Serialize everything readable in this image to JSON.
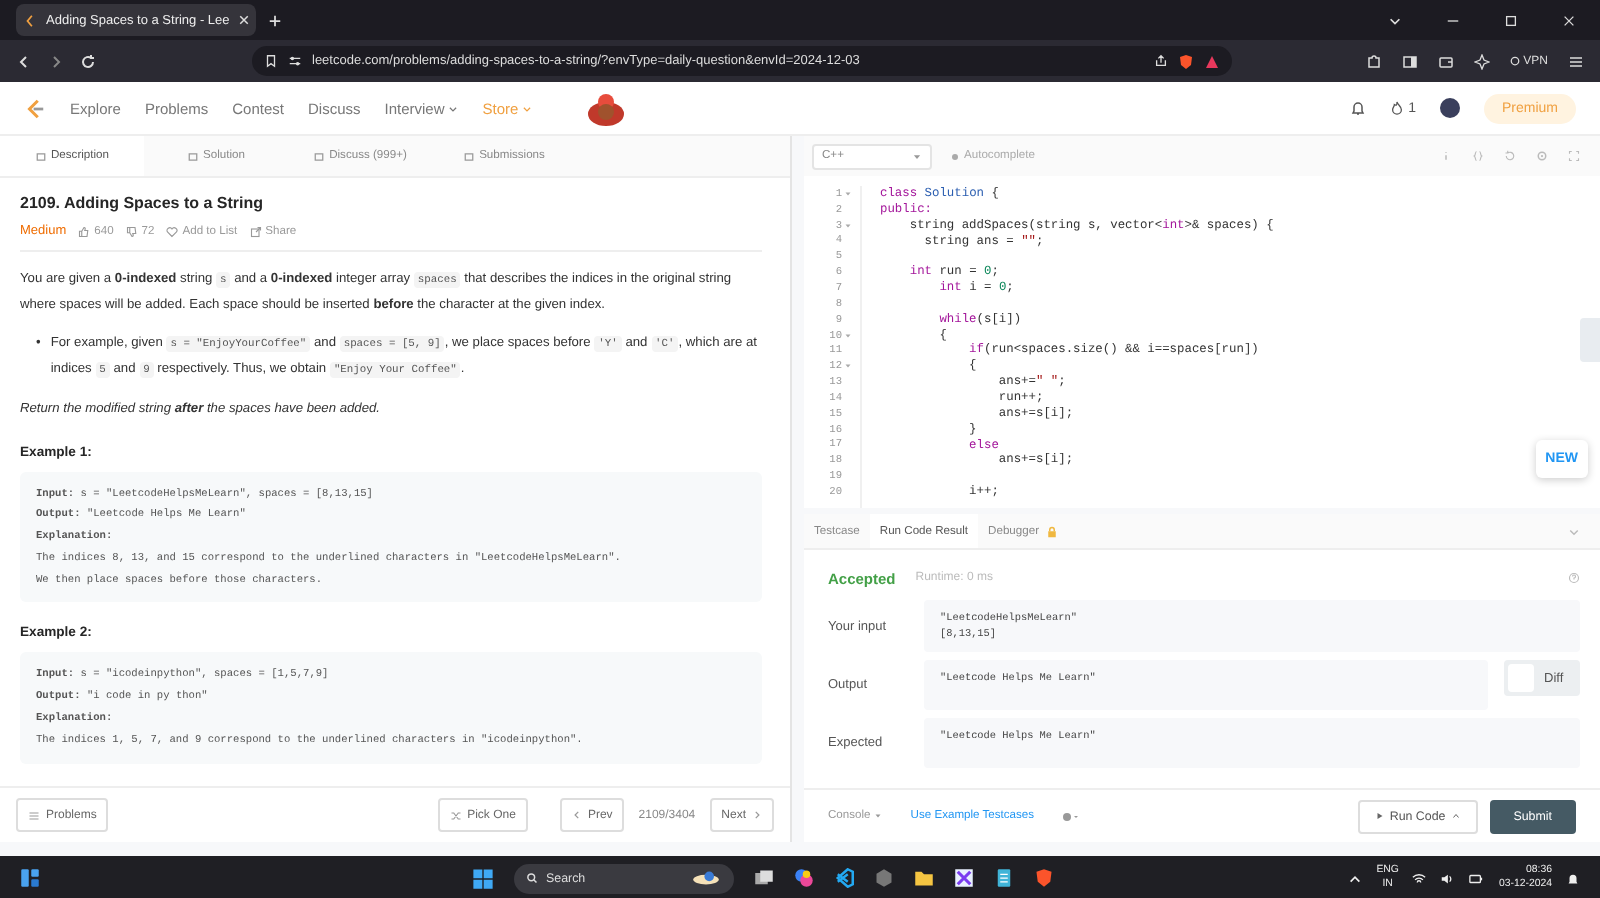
{
  "browser": {
    "tab_title": "Adding Spaces to a String - Lee",
    "url": "leetcode.com/problems/adding-spaces-to-a-string/?envType=daily-question&envId=2024-12-03",
    "vpn": "VPN"
  },
  "site_nav": {
    "items": [
      {
        "label": "Explore",
        "kind": "link"
      },
      {
        "label": "Problems",
        "kind": "link"
      },
      {
        "label": "Contest",
        "kind": "link"
      },
      {
        "label": "Discuss",
        "kind": "link"
      },
      {
        "label": "Interview",
        "kind": "dropdown"
      },
      {
        "label": "Store",
        "kind": "store"
      }
    ],
    "streak": "1",
    "premium": "Premium"
  },
  "left_panel": {
    "tabs": [
      {
        "label": "Description",
        "selected": true
      },
      {
        "label": "Solution",
        "selected": false
      },
      {
        "label": "Discuss (999+)",
        "selected": false
      },
      {
        "label": "Submissions",
        "selected": false
      }
    ],
    "problem": {
      "title": "2109. Adding Spaces to a String",
      "difficulty": "Medium",
      "likes": "640",
      "dislikes": "72",
      "add_to_list": "Add to List",
      "share": "Share",
      "paragraphs": [
        {
          "kind": "para",
          "segments": [
            {
              "kind": "text",
              "text": "You are given a **0-indexed** string "
            },
            {
              "kind": "code",
              "text": "s"
            },
            {
              "kind": "text",
              "text": " and a **0-indexed** integer array "
            },
            {
              "kind": "code",
              "text": "spaces"
            },
            {
              "kind": "text",
              "text": " that describes the indices in the original string where spaces will be added. Each space should be inserted **before** the character at the given index."
            }
          ]
        },
        {
          "kind": "bullet",
          "marker": "•",
          "segments": [
            {
              "kind": "text",
              "text": "For example, given "
            },
            {
              "kind": "code",
              "text": "s = \"EnjoyYourCoffee\""
            },
            {
              "kind": "text",
              "text": " and "
            },
            {
              "kind": "code",
              "text": "spaces = [5, 9]"
            },
            {
              "kind": "text",
              "text": ", we place spaces before "
            },
            {
              "kind": "code",
              "text": "'Y'"
            },
            {
              "kind": "text",
              "text": " and "
            },
            {
              "kind": "code",
              "text": "'C'"
            },
            {
              "kind": "text",
              "text": ", which are at indices "
            },
            {
              "kind": "code",
              "text": "5"
            },
            {
              "kind": "text",
              "text": " and "
            },
            {
              "kind": "code",
              "text": "9"
            },
            {
              "kind": "text",
              "text": " respectively. Thus, we obtain "
            },
            {
              "kind": "code",
              "text": "\"Enjoy Your Coffee\""
            },
            {
              "kind": "text",
              "text": "."
            }
          ]
        },
        {
          "kind": "italic",
          "segments": [
            {
              "kind": "text",
              "text": "Return the modified string **after** the spaces have been added."
            }
          ]
        }
      ],
      "examples": [
        {
          "title": "Example 1:",
          "lines": [
            "**Input:** s = \"LeetcodeHelpsMeLearn\", spaces = [8,13,15]",
            "**Output:** \"Leetcode Helps Me Learn\"",
            "**Explanation:**",
            "The indices 8, 13, and 15 correspond to the underlined characters in \"LeetcodeHelpsMeLearn\".",
            "We then place spaces before those characters."
          ]
        },
        {
          "title": "Example 2:",
          "lines": [
            "**Input:** s = \"icodeinpython\", spaces = [1,5,7,9]",
            "**Output:** \"i code in py thon\"",
            "**Explanation:**",
            "The indices 1, 5, 7, and 9 correspond to the underlined characters in \"icodeinpython\"."
          ]
        }
      ]
    },
    "footer": {
      "problems": "Problems",
      "pick_one": "Pick One",
      "prev": "Prev",
      "position": "2109/3404",
      "next": "Next"
    }
  },
  "editor": {
    "language": "C++",
    "autocomplete": "Autocomplete",
    "new_badge": "NEW",
    "lines": [
      {
        "num": "1",
        "fold": true,
        "tokens": [
          {
            "kind": "keyword",
            "text": "class"
          },
          {
            "kind": "type",
            "text": " Solution"
          },
          {
            "kind": "plain",
            "text": " {"
          }
        ]
      },
      {
        "num": "2",
        "fold": false,
        "tokens": [
          {
            "kind": "keyword",
            "text": "public:"
          }
        ]
      },
      {
        "num": "3",
        "fold": true,
        "tokens": [
          {
            "kind": "plain",
            "text": "    string addSpaces(string s, vector<"
          },
          {
            "kind": "keyword",
            "text": "int"
          },
          {
            "kind": "plain",
            "text": ">& spaces) {"
          }
        ]
      },
      {
        "num": "4",
        "fold": false,
        "tokens": [
          {
            "kind": "plain",
            "text": "      string ans = "
          },
          {
            "kind": "string",
            "text": "\"\""
          },
          {
            "kind": "plain",
            "text": ";"
          }
        ]
      },
      {
        "num": "5",
        "fold": false
      },
      {
        "num": "6",
        "fold": false,
        "tokens": [
          {
            "kind": "keyword",
            "text": "    int"
          },
          {
            "kind": "plain",
            "text": " run = "
          },
          {
            "kind": "number",
            "text": "0"
          },
          {
            "kind": "plain",
            "text": ";"
          }
        ]
      },
      {
        "num": "7",
        "fold": false,
        "tokens": [
          {
            "kind": "keyword",
            "text": "        int"
          },
          {
            "kind": "plain",
            "text": " i = "
          },
          {
            "kind": "number",
            "text": "0"
          },
          {
            "kind": "plain",
            "text": ";"
          }
        ]
      },
      {
        "num": "8",
        "fold": false
      },
      {
        "num": "9",
        "fold": false,
        "tokens": [
          {
            "kind": "keyword",
            "text": "        while"
          },
          {
            "kind": "plain",
            "text": "(s[i])"
          }
        ]
      },
      {
        "num": "10",
        "fold": true,
        "tokens": [
          {
            "kind": "plain",
            "text": "        {"
          }
        ]
      },
      {
        "num": "11",
        "fold": false,
        "tokens": [
          {
            "kind": "keyword",
            "text": "            if"
          },
          {
            "kind": "plain",
            "text": "(run<spaces.size() && i==spaces[run])"
          }
        ]
      },
      {
        "num": "12",
        "fold": true,
        "tokens": [
          {
            "kind": "plain",
            "text": "            {"
          }
        ]
      },
      {
        "num": "13",
        "fold": false,
        "tokens": [
          {
            "kind": "plain",
            "text": "                ans+="
          },
          {
            "kind": "string",
            "text": "\" \""
          },
          {
            "kind": "plain",
            "text": ";"
          }
        ]
      },
      {
        "num": "14",
        "fold": false,
        "tokens": [
          {
            "kind": "plain",
            "text": "                run++;"
          }
        ]
      },
      {
        "num": "15",
        "fold": false,
        "tokens": [
          {
            "kind": "plain",
            "text": "                ans+=s[i];"
          }
        ]
      },
      {
        "num": "16",
        "fold": false,
        "tokens": [
          {
            "kind": "plain",
            "text": "            }"
          }
        ]
      },
      {
        "num": "17",
        "fold": false,
        "tokens": [
          {
            "kind": "keyword",
            "text": "            else"
          }
        ]
      },
      {
        "num": "18",
        "fold": false,
        "tokens": [
          {
            "kind": "plain",
            "text": "                ans+=s[i];"
          }
        ]
      },
      {
        "num": "19",
        "fold": false
      },
      {
        "num": "20",
        "fold": false,
        "tokens": [
          {
            "kind": "plain",
            "text": "            i++;"
          }
        ]
      }
    ]
  },
  "result": {
    "tabs": [
      {
        "label": "Testcase",
        "selected": false,
        "locked": false
      },
      {
        "label": "Run Code Result",
        "selected": true,
        "locked": false
      },
      {
        "label": "Debugger",
        "selected": false,
        "locked": true
      }
    ],
    "status": "Accepted",
    "runtime": "Runtime: 0 ms",
    "rows": [
      {
        "label": "Your input",
        "kind": "plain",
        "lines": [
          "\"LeetcodeHelpsMeLearn\"",
          "[8,13,15]"
        ]
      },
      {
        "label": "Output",
        "kind": "diff",
        "lines": [
          "\"Leetcode Helps Me Learn\""
        ],
        "diff_label": "Diff",
        "diff_on": false
      },
      {
        "label": "Expected",
        "kind": "plain",
        "lines": [
          "\"Leetcode Helps Me Learn\""
        ]
      }
    ],
    "footer": {
      "console": "Console",
      "use_example": "Use Example Testcases",
      "run_code": "Run Code",
      "submit": "Submit"
    }
  },
  "taskbar": {
    "search": "Search",
    "lang": "ENG",
    "region": "IN",
    "time": "08:36",
    "date": "03-12-2024"
  }
}
